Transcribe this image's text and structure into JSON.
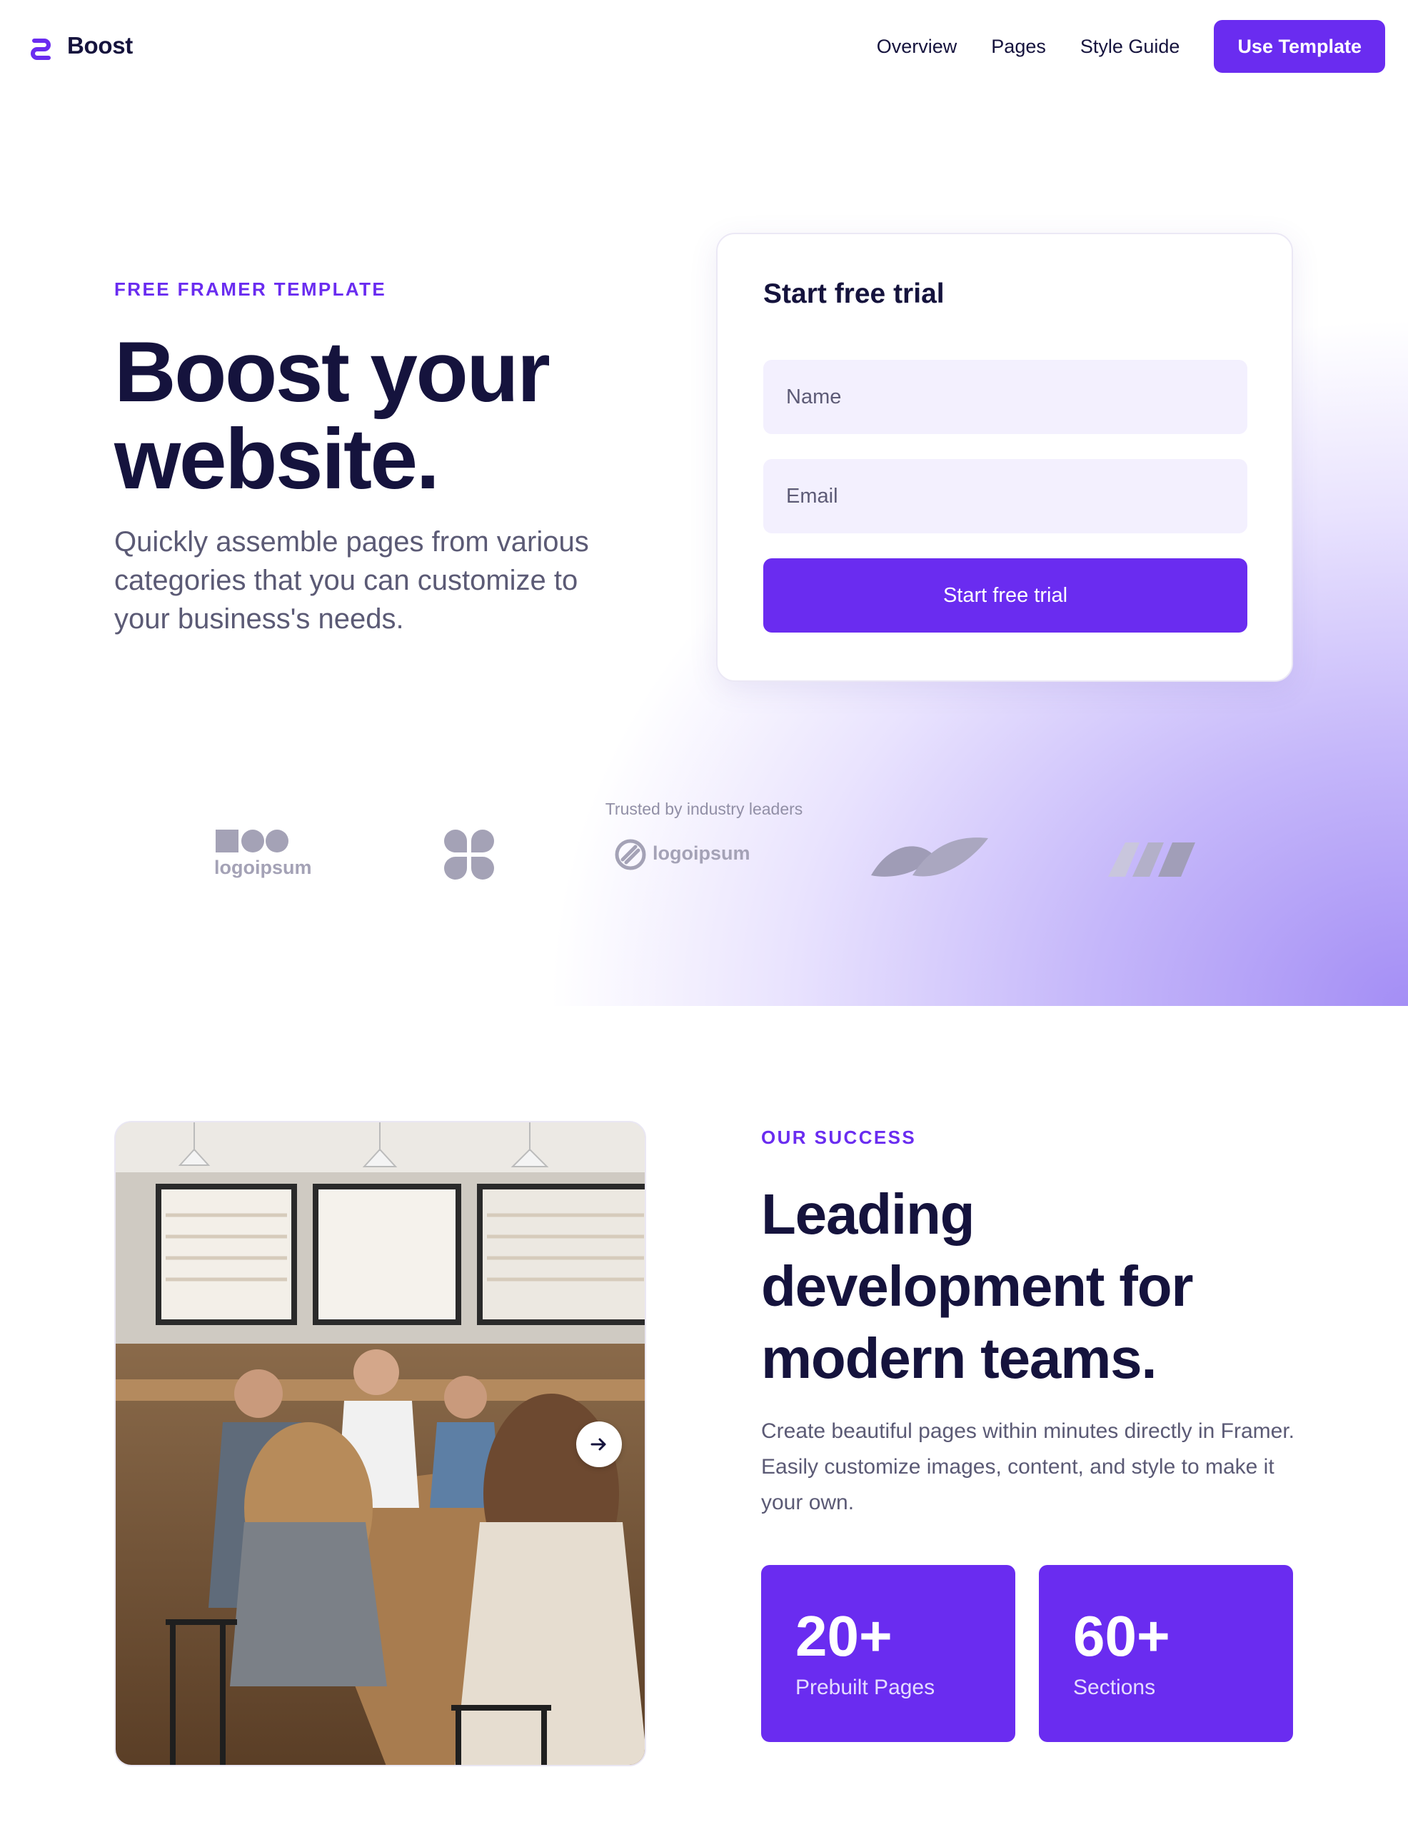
{
  "nav": {
    "brand": "Boost",
    "links": [
      "Overview",
      "Pages",
      "Style Guide"
    ],
    "cta": "Use Template"
  },
  "hero": {
    "eyebrow": "FREE FRAMER TEMPLATE",
    "title_line1": "Boost your",
    "title_line2": "website.",
    "subtitle": "Quickly assemble pages from various categories that you can customize to your business's needs."
  },
  "trial_form": {
    "title": "Start free trial",
    "name_placeholder": "Name",
    "email_placeholder": "Email",
    "submit_label": "Start free trial"
  },
  "trusted": {
    "label": "Trusted by industry leaders",
    "logos": [
      "logoipsum",
      "",
      "logoipsum",
      "",
      ""
    ],
    "logo_icons": [
      "square-circles-logo",
      "clover-logo",
      "ring-logo",
      "wave-logo",
      "stripes-logo"
    ]
  },
  "success": {
    "eyebrow": "OUR SUCCESS",
    "title_line1": "Leading",
    "title_line2": "development for",
    "title_line3": "modern teams.",
    "body": "Create beautiful pages within minutes directly in Framer. Easily customize images, content, and style to make it your own.",
    "stats": [
      {
        "value": "20+",
        "label": "Prebuilt Pages"
      },
      {
        "value": "60+",
        "label": "Sections"
      }
    ],
    "photo_icon": "team-meeting-photo",
    "arrow_icon": "arrow-right-icon"
  },
  "colors": {
    "accent": "#6a2cf0",
    "heading": "#15133d",
    "body_text": "#5b5a75",
    "field_bg": "#f3f0fe",
    "gradient": "#a48ef5"
  }
}
